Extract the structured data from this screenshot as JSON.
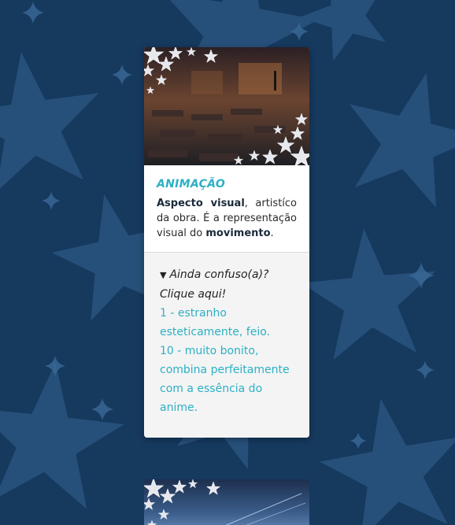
{
  "card": {
    "title": "ANIMAÇÃO",
    "desc_bold1": "Aspecto visual",
    "desc_text1": ", artistíco da obra. É a representação visual do ",
    "desc_bold2": "movimento",
    "desc_text2": ".",
    "details": {
      "summary": "Ainda confuso(a)?",
      "hint": "Clique aqui!",
      "line1": "1 - estranho esteticamente, feio.",
      "line2": "10 - muito bonito, combina perfeitamente com a essência do anime."
    }
  },
  "colors": {
    "background": "#16395e",
    "accent": "#2cb0c4",
    "star": "#2a5580"
  },
  "icons": {
    "disclosure": "triangle-down-icon",
    "image_overlay": "star-icon"
  }
}
